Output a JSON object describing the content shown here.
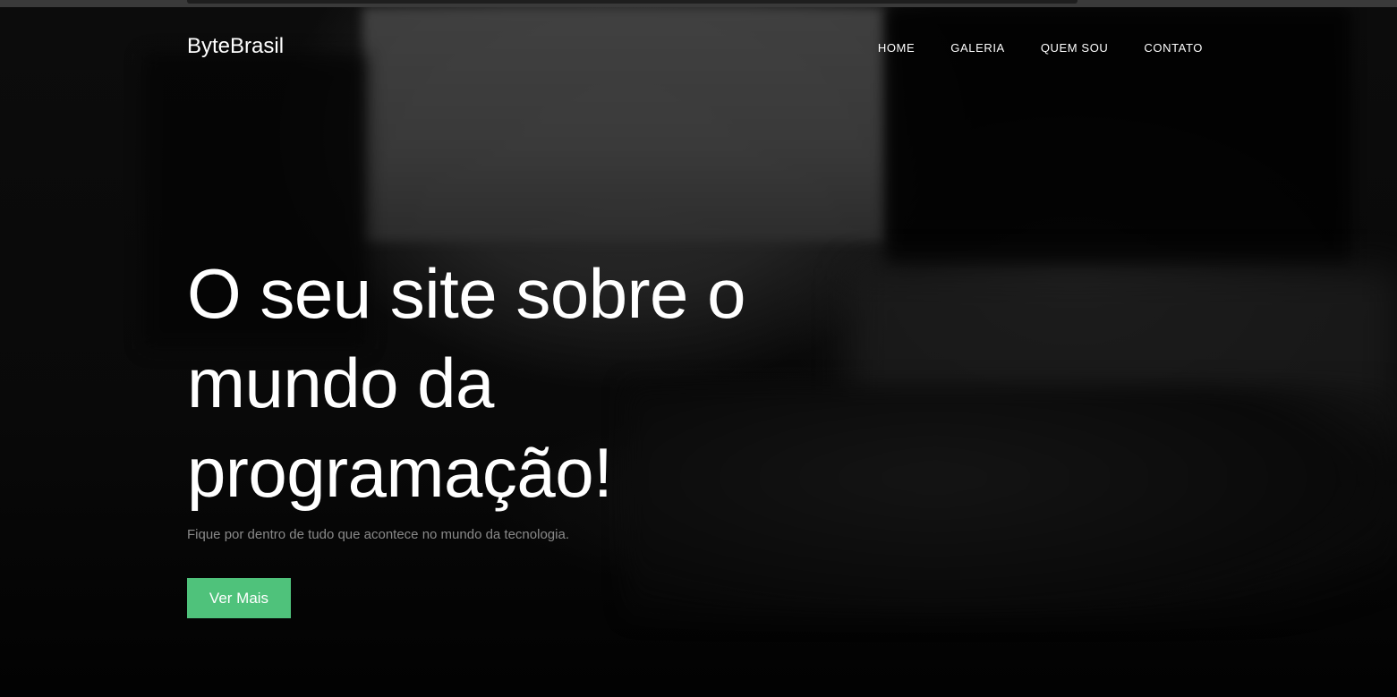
{
  "brand": {
    "name": "ByteBrasil"
  },
  "nav": {
    "items": [
      {
        "label": "HOME"
      },
      {
        "label": "GALERIA"
      },
      {
        "label": "QUEM SOU"
      },
      {
        "label": "CONTATO"
      }
    ]
  },
  "hero": {
    "title": "O seu site sobre o mundo da programação!",
    "subtitle": "Fique por dentro de tudo que acontece no mundo da tecnologia.",
    "cta_label": "Ver Mais"
  },
  "colors": {
    "accent": "#4fc27b",
    "background": "#0a0a0a",
    "text": "#ffffff",
    "muted_text": "#8a8a8a"
  }
}
